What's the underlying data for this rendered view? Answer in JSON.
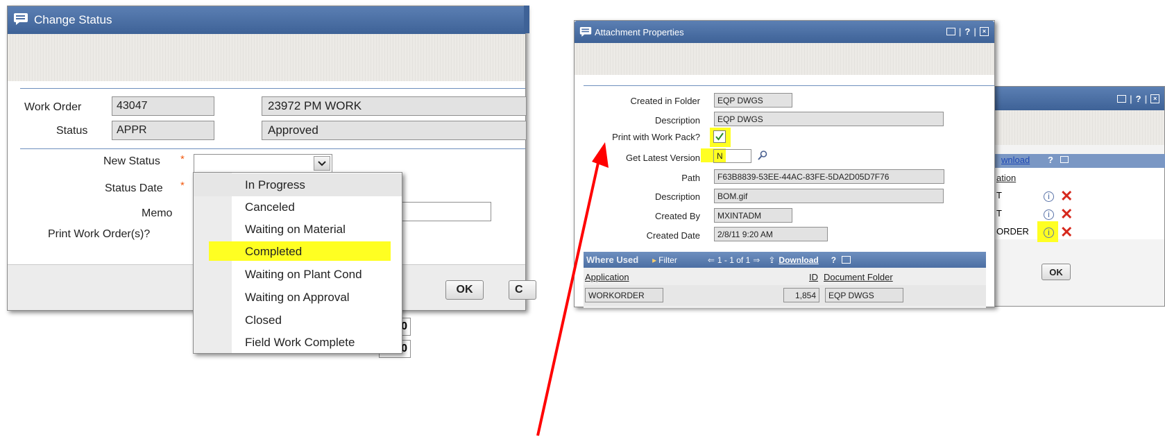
{
  "change_status": {
    "title": "Change Status",
    "work_order_label": "Work Order",
    "work_order_value": "43047",
    "work_order_desc": "23972 PM WORK",
    "status_label": "Status",
    "status_value": "APPR",
    "status_desc": "Approved",
    "new_status_label": "New Status",
    "status_date_label": "Status Date",
    "memo_label": "Memo",
    "print_label": "Print Work Order(s)?",
    "required_mark": "*",
    "ok_label": "OK",
    "cancel_partial": "C",
    "dropdown_options": [
      "In Progress",
      "Canceled",
      "Waiting on Material",
      "Completed",
      "Waiting on Plant Cond",
      "Waiting on Approval",
      "Closed",
      "Field Work Complete"
    ],
    "highlighted_option": "Completed",
    "partial_value_1": "0",
    "partial_value_2": "0"
  },
  "attachment": {
    "title": "Attachment Properties",
    "created_in_folder_label": "Created in Folder",
    "created_in_folder_value": "EQP DWGS",
    "description_label": "Description",
    "description_value": "EQP DWGS",
    "print_wp_label": "Print with Work Pack?",
    "print_wp_checked": true,
    "latest_version_label": "Get Latest Version",
    "latest_version_value": "N",
    "path_label": "Path",
    "path_value": "F63B8839-53EE-44AC-83FE-5DA2D05D7F76",
    "description2_label": "Description",
    "description2_value": "BOM.gif",
    "created_by_label": "Created By",
    "created_by_value": "MXINTADM",
    "created_date_label": "Created Date",
    "created_date_value": "2/8/11 9:20 AM",
    "where_used": {
      "title": "Where Used",
      "filter_label": "Filter",
      "pagination": "1 - 1 of 1",
      "download_label": "Download",
      "help": "?",
      "col_application": "Application",
      "col_id": "ID",
      "col_folder": "Document Folder",
      "rows": [
        {
          "application": "WORKORDER",
          "id": "1,854",
          "folder": "EQP DWGS"
        }
      ]
    }
  },
  "background_panel": {
    "download_partial": "wnload",
    "ation_partial": "ation",
    "row1_text": "T",
    "row2_text": "T",
    "row3_text": "ORDER",
    "ok_label": "OK",
    "help": "?"
  },
  "colors": {
    "title_bar": "#4a6ea5",
    "highlight": "#ffff22",
    "arrow": "#ff0000",
    "delete_icon": "#d6281c",
    "link": "#1b46b4"
  }
}
